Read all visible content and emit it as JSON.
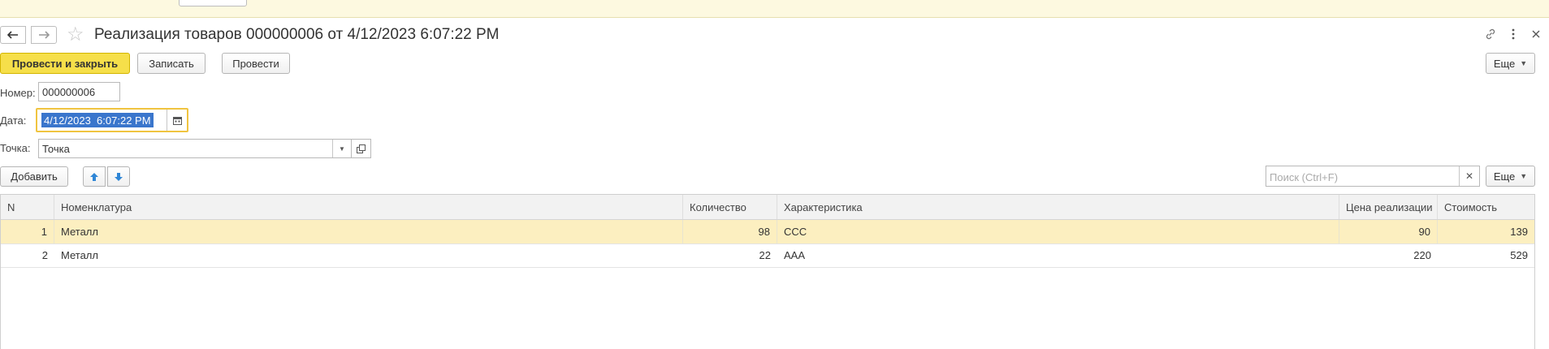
{
  "header": {
    "title": "Реализация товаров 000000006 от 4/12/2023 6:07:22 PM"
  },
  "nav": {
    "back_icon": "arrow-left-icon",
    "forward_icon": "arrow-right-icon",
    "favorite_icon": "star-icon"
  },
  "window_icons": [
    "link-icon",
    "more-vertical-icon",
    "close-icon"
  ],
  "toolbar": {
    "post_close": "Провести и закрыть",
    "save": "Записать",
    "post": "Провести",
    "more": "Еще"
  },
  "form": {
    "number_label": "Номер:",
    "number_value": "000000006",
    "date_label": "Дата:",
    "date_value": "4/12/2023  6:07:22 PM",
    "point_label": "Точка:",
    "point_value": "Точка"
  },
  "table_toolbar": {
    "add": "Добавить",
    "search_placeholder": "Поиск (Ctrl+F)",
    "more": "Еще"
  },
  "table": {
    "columns": [
      "N",
      "Номенклатура",
      "Количество",
      "Характеристика",
      "Цена реализации",
      "Стоимость"
    ],
    "rows": [
      {
        "n": "1",
        "item": "Металл",
        "qty": "98",
        "char": "ССС",
        "price": "90",
        "cost": "139"
      },
      {
        "n": "2",
        "item": "Металл",
        "qty": "22",
        "char": "ААА",
        "price": "220",
        "cost": "529"
      }
    ]
  },
  "colors": {
    "primary_button": "#f6df4a",
    "selected_row": "#fcefc0",
    "focus_border": "#f0c440",
    "selection": "#3a76cc",
    "arrow_blue": "#2f86d6"
  }
}
